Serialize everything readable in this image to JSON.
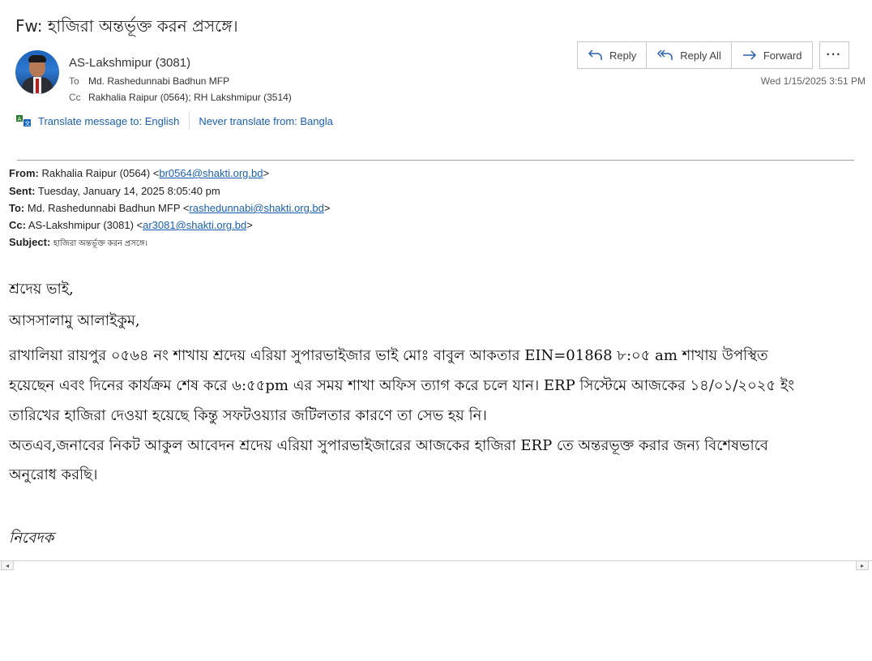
{
  "subject": "Fw: হাজিরা অন্তর্ভূক্ত করন প্রসঙ্গে।",
  "sender": "AS-Lakshmipur (3081)",
  "to": {
    "label": "To",
    "value": "Md. Rashedunnabi Badhun MFP"
  },
  "cc": {
    "label": "Cc",
    "value": "Rakhalia Raipur (0564); RH Lakshmipur (3514)"
  },
  "translate": {
    "translate_label": "Translate message to: English",
    "never_label": "Never translate from: Bangla"
  },
  "actions": {
    "reply": "Reply",
    "reply_all": "Reply All",
    "forward": "Forward",
    "more": "···"
  },
  "date": "Wed 1/15/2025 3:51 PM",
  "forwarded": {
    "from_label": "From:",
    "from_name": "Rakhalia Raipur (0564) <",
    "from_email": "br0564@shakti.org.bd",
    "from_end": ">",
    "sent_label": "Sent:",
    "sent_value": "Tuesday, January 14, 2025 8:05:40 pm",
    "to_label": "To:",
    "to_name": "Md. Rashedunnabi Badhun MFP <",
    "to_email": "rashedunnabi@shakti.org.bd",
    "to_end": ">",
    "cc_label": "Cc:",
    "cc_name": "AS-Lakshmipur (3081) <",
    "cc_email": "ar3081@shakti.org.bd",
    "cc_end": ">",
    "subject_label": "Subject:",
    "subject_value": "হাজিরা অন্তর্ভূক্ত করন প্রসঙ্গে।"
  },
  "body": {
    "line1": "শ্রদেয়  ভাই,",
    "line2": "আসসালামু আলাইকুম,",
    "line3": "রাখালিয়া  রায়পুর  ০৫৬৪  নং  শাখায় শ্রদেয় এরিয়া সুপারভাইজার ভাই মোঃ বাবুল আকতার EIN=01868  ৮:০৫ am শাখায় উপস্থিত",
    "line4": "হয়েছেন এবং দিনের কার্যক্রম শেষ করে ৬:৫৫pm এর সময় শাখা অফিস ত্যাগ করে চলে যান। ERP সিস্টেমে আজকের ১৪/০১/২০২৫ ইং",
    "line5": "তারিখের  হাজিরা দেওয়া হয়েছে কিন্তু সফটওয়্যার জটিলতার কারণে তা সেভ হয় নি।",
    "line6": "অতএব,জনাবের নিকট আকুল আবেদন শ্রদেয় এরিয়া সুপারভাইজারের আজকের হাজিরা ERP তে অন্তরভূক্ত করার জন্য  বিশেষভাবে",
    "line7": "অনুরোধ করছি।",
    "signature": "নিবেদক"
  },
  "colors": {
    "link": "#1a5fb4",
    "text": "#222222",
    "border": "#c8c8c8"
  }
}
